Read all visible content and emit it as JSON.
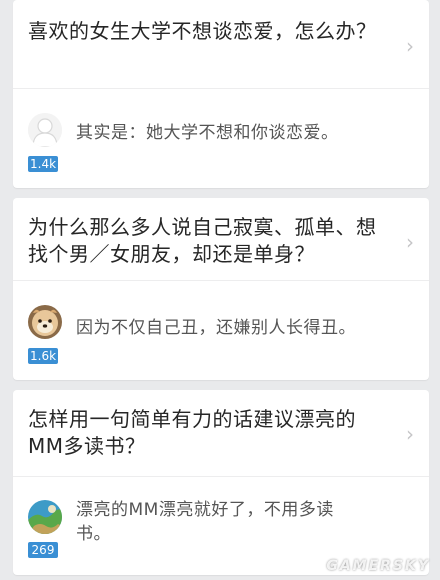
{
  "cards": [
    {
      "question": "喜欢的女生大学不想谈恋爱，怎么办？",
      "answer": "其实是：她大学不想和你谈恋爱。",
      "votes": "1.4k",
      "avatar_icon": "default-avatar-icon"
    },
    {
      "question": "为什么那么多人说自己寂寞、孤单、想找个男／女朋友，却还是单身？",
      "answer": "因为不仅自己丑，还嫌别人长得丑。",
      "votes": "1.6k",
      "avatar_icon": "dog-avatar-icon"
    },
    {
      "question": "怎样用一句简单有力的话建议漂亮的MM多读书？",
      "answer": "漂亮的MM漂亮就好了，不用多读书。",
      "votes": "269",
      "avatar_icon": "globe-avatar-icon"
    }
  ],
  "chevron_icon": "chevron-right-icon",
  "watermark": "GAMERSKY",
  "colors": {
    "background": "#e9eaec",
    "card": "#ffffff",
    "vote_badge": "#3a8fd4",
    "question_text": "#262626",
    "answer_text": "#555555"
  }
}
